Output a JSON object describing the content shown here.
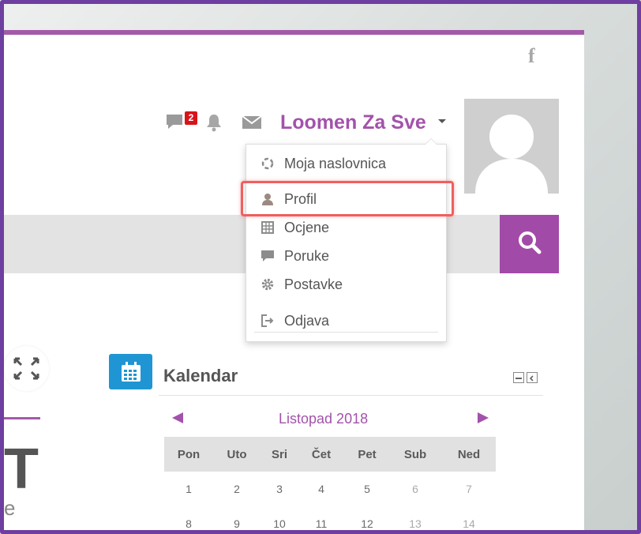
{
  "header": {
    "facebook_icon": "facebook-icon",
    "message_badge": "2",
    "username": "Loomen Za Sve",
    "icons": [
      "chat-icon",
      "bell-icon",
      "mail-icon"
    ]
  },
  "user_menu": {
    "items": [
      {
        "label": "Moja naslovnica",
        "icon": "dashboard-icon"
      },
      {
        "label": "Profil",
        "icon": "user-icon",
        "highlighted": true
      },
      {
        "label": "Ocjene",
        "icon": "grades-icon"
      },
      {
        "label": "Poruke",
        "icon": "message-icon"
      },
      {
        "label": "Postavke",
        "icon": "gear-icon"
      },
      {
        "label": "Odjava",
        "icon": "logout-icon"
      }
    ]
  },
  "calendar": {
    "title": "Kalendar",
    "month": "Listopad 2018",
    "weekdays": [
      "Pon",
      "Uto",
      "Sri",
      "Čet",
      "Pet",
      "Sub",
      "Ned"
    ],
    "rows": [
      [
        "1",
        "2",
        "3",
        "4",
        "5",
        "6",
        "7"
      ],
      [
        "8",
        "9",
        "10",
        "11",
        "12",
        "13",
        "14"
      ]
    ]
  },
  "left_panel": {
    "big_letter": "T",
    "small_letter": "e"
  },
  "colors": {
    "accent": "#a352ab",
    "badge": "#d7141a",
    "calendar_icon": "#1f96d3",
    "highlight": "#ef5f5f",
    "frame": "#6e3ea0"
  }
}
